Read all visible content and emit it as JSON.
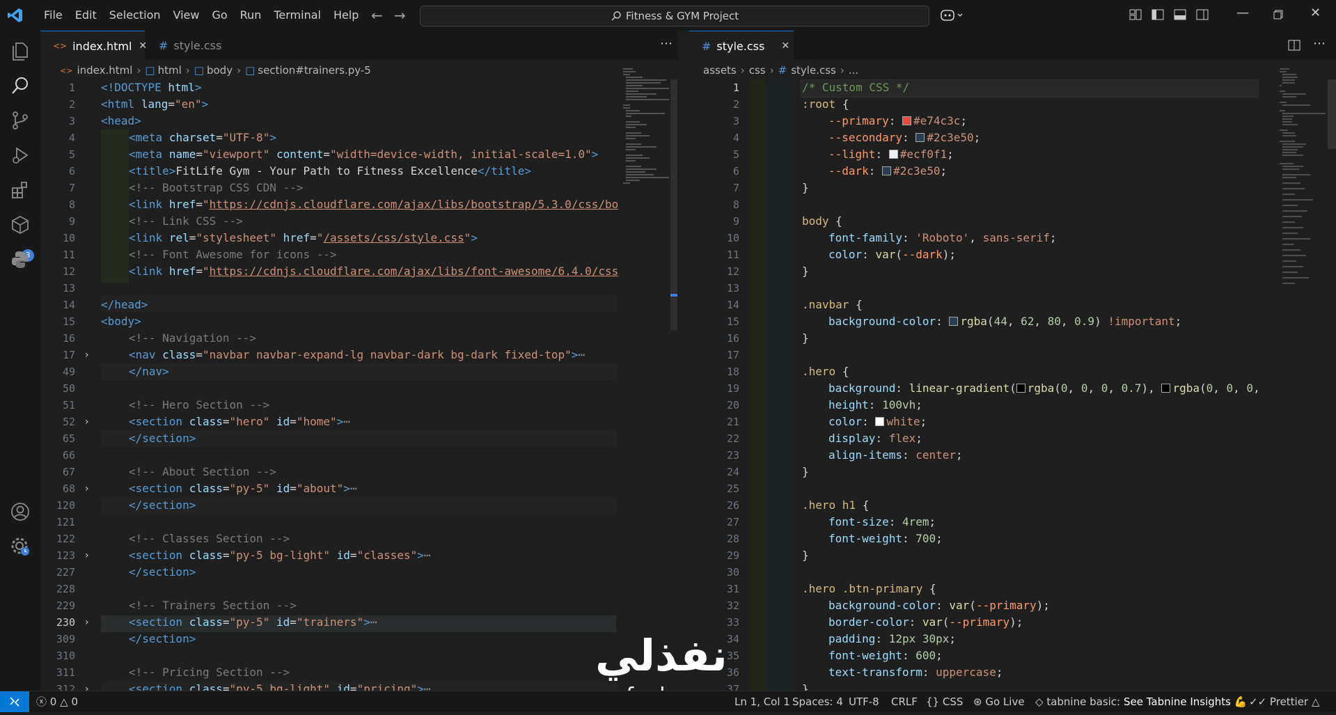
{
  "menu": [
    "File",
    "Edit",
    "Selection",
    "View",
    "Go",
    "Run",
    "Terminal",
    "Help"
  ],
  "command_center": {
    "label": "Fitness & GYM Project"
  },
  "activity": {
    "extensions_badge": "3"
  },
  "left": {
    "tabs": [
      {
        "label": "index.html",
        "active": true
      },
      {
        "label": "style.css",
        "active": false
      }
    ],
    "breadcrumb": [
      "index.html",
      "html",
      "body",
      "section#trainers.py-5"
    ],
    "line_numbers": [
      "1",
      "2",
      "3",
      "4",
      "5",
      "6",
      "7",
      "8",
      "9",
      "10",
      "11",
      "12",
      "13",
      "14",
      "15",
      "16",
      "17",
      "49",
      "50",
      "51",
      "52",
      "65",
      "66",
      "67",
      "68",
      "120",
      "121",
      "122",
      "123",
      "227",
      "228",
      "229",
      "230",
      "309",
      "310",
      "311",
      "312"
    ],
    "folded_lines": [
      "17",
      "52",
      "68",
      "123",
      "230",
      "312"
    ]
  },
  "right": {
    "tabs": [
      {
        "label": "style.css",
        "active": true
      }
    ],
    "breadcrumb": [
      "assets",
      "css",
      "style.css",
      "..."
    ]
  },
  "colors": {
    "primary": "#e74c3c",
    "secondary": "#2c3e50",
    "light": "#ecf0f1",
    "dark": "#2c3e50",
    "accent": "#0078d4"
  },
  "status": {
    "errors": "0",
    "warnings": "0",
    "cursor": "Ln 1, Col 1",
    "spaces": "Spaces: 4",
    "encoding": "UTF-8",
    "eol": "CRLF",
    "language": "CSS",
    "golive": "Go Live",
    "tabnine": "tabnine basic:",
    "tabnine_insights": "See Tabnine Insights 💪",
    "prettier": "Prettier"
  },
  "watermark": {
    "arabic": "نفذلي",
    "latin": "nafezly.com"
  }
}
